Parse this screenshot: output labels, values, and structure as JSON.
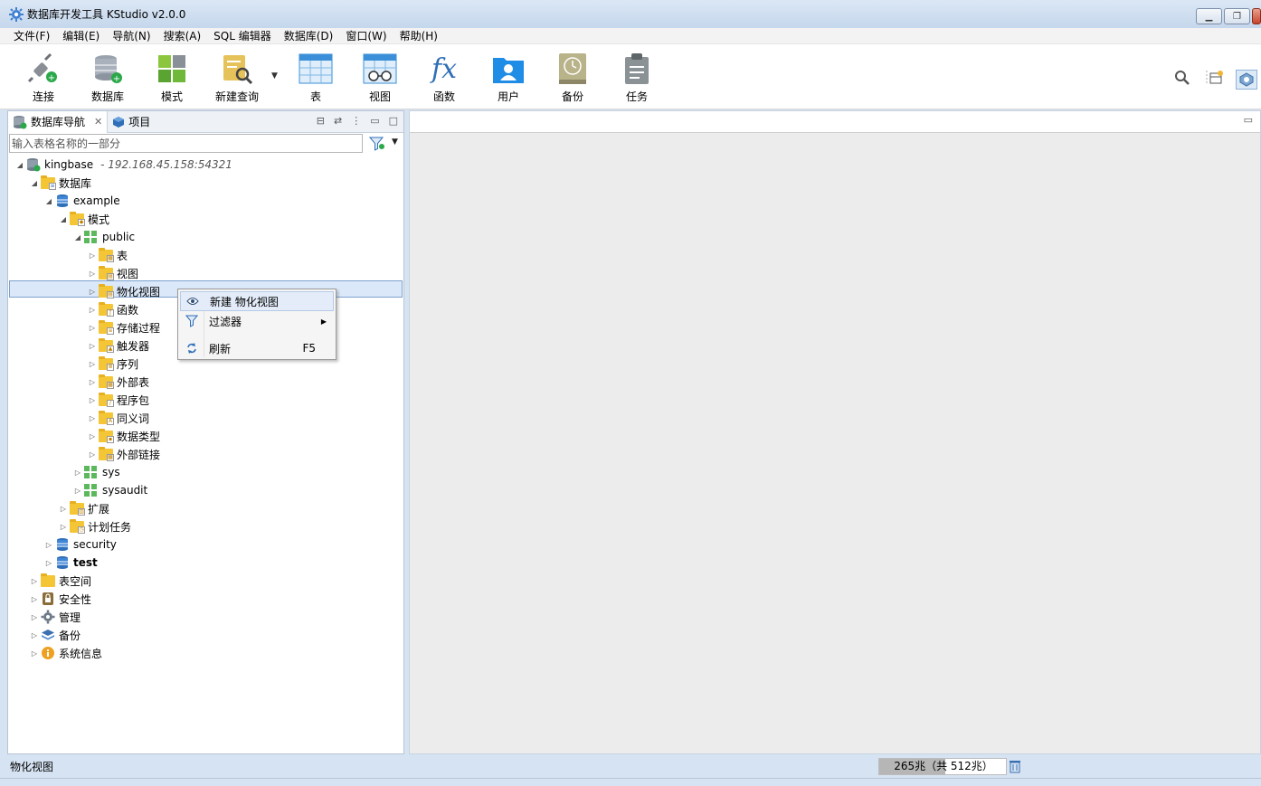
{
  "window": {
    "title": "数据库开发工具 KStudio v2.0.0"
  },
  "menubar": [
    "文件(F)",
    "编辑(E)",
    "导航(N)",
    "搜索(A)",
    "SQL 编辑器",
    "数据库(D)",
    "窗口(W)",
    "帮助(H)"
  ],
  "toolbar": {
    "connect": "连接",
    "database": "数据库",
    "schema": "模式",
    "new_query": "新建查询",
    "table": "表",
    "view": "视图",
    "function": "函数",
    "user": "用户",
    "backup": "备份",
    "task": "任务"
  },
  "left_panel": {
    "tab_navigator": "数据库导航",
    "tab_project": "项目",
    "filter_placeholder": "输入表格名称的一部分"
  },
  "tree": {
    "root_label": "kingbase",
    "root_host": "- 192.168.45.158:54321",
    "databases": "数据库",
    "example": "example",
    "schemas": "模式",
    "public": "public",
    "tables": "表",
    "views": "视图",
    "matviews": "物化视图",
    "functions": "函数",
    "procedures": "存储过程",
    "triggers": "触发器",
    "sequences": "序列",
    "foreign_tables": "外部表",
    "packages": "程序包",
    "synonyms": "同义词",
    "datatypes": "数据类型",
    "external_links": "外部链接",
    "sys": "sys",
    "sysaudit": "sysaudit",
    "extensions": "扩展",
    "jobs": "计划任务",
    "security_db": "security",
    "test_db": "test",
    "tablespaces": "表空间",
    "security": "安全性",
    "admin": "管理",
    "backup": "备份",
    "sysinfo": "系统信息"
  },
  "context_menu": {
    "new_matview": "新建 物化视图",
    "filter": "过滤器",
    "refresh": "刷新",
    "refresh_shortcut": "F5"
  },
  "status": {
    "text": "物化视图",
    "heap_label": "265兆（共 512兆）",
    "heap_used_fraction": 0.52
  }
}
